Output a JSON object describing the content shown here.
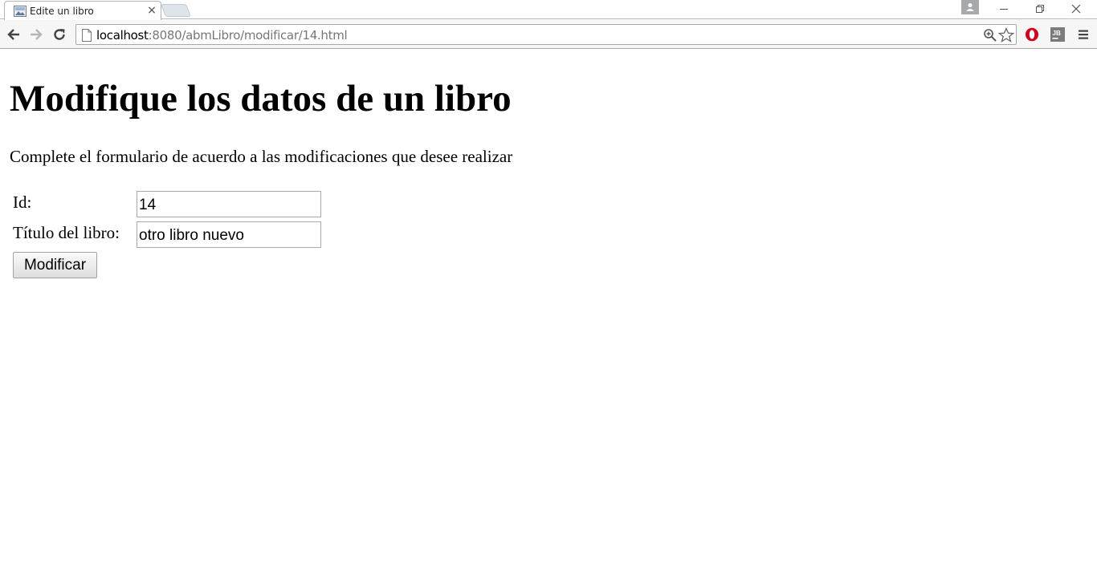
{
  "browser": {
    "tab": {
      "title": "Edite un libro",
      "close_glyph": "×",
      "favicon": "document-image-icon"
    },
    "new_tab": "new-tab-button",
    "window_controls": [
      "minimize-icon",
      "restore-icon",
      "close-icon"
    ],
    "address_bar": {
      "host": "localhost",
      "path": ":8080/abmLibro/modificar/14.html"
    },
    "extensions": [
      "opera-icon",
      "jetbrains-icon",
      "hamburger-menu-icon"
    ],
    "colors": {
      "opera_red": "#d0021b",
      "profile_gray": "#a7a9ad"
    }
  },
  "page": {
    "heading": "Modifique los datos de un libro",
    "intro": "Complete el formulario de acuerdo a las modificaciones que desee realizar",
    "form": {
      "id_label": "Id:",
      "id_value": "14",
      "title_label": "Título del libro:",
      "title_value": "otro libro nuevo",
      "submit_label": "Modificar"
    }
  }
}
